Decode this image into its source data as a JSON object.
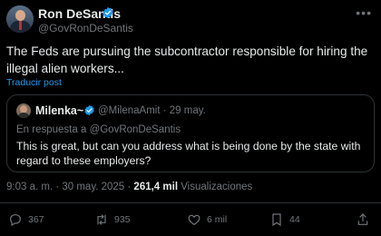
{
  "author": {
    "name": "Ron DeSantis",
    "handle": "@GovRonDeSantis",
    "verified_color": "#1d9bf0"
  },
  "tweet": {
    "text": "The Feds are pursuing the subcontractor responsible for hiring the illegal alien workers...",
    "translate_label": "Traducir post"
  },
  "quote": {
    "name": "Milenka~",
    "handle_date": "@MilenaAmit · 29 may.",
    "reply_prefix": "En respuesta a ",
    "reply_handle": "@GovRonDeSantis",
    "text": "This is great, but can you address what is being done by the state with regard to these employers?"
  },
  "meta": {
    "time_date": "9:03 a. m. · 30 may. 2025 · ",
    "views_count": "261,4 mil",
    "views_label": " Visualizaciones"
  },
  "actions": {
    "replies": "367",
    "reposts": "935",
    "likes": "6 mil",
    "bookmarks": "44"
  },
  "icons": {
    "more": "more-icon",
    "reply": "reply-icon",
    "repost": "repost-icon",
    "like": "heart-icon",
    "bookmark": "bookmark-icon",
    "share": "share-icon"
  }
}
